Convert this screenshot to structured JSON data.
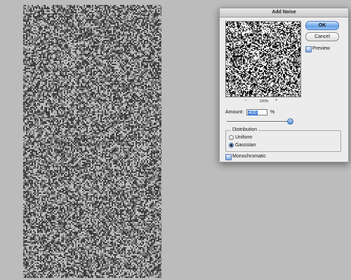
{
  "dialog": {
    "title": "Add Noise",
    "ok_label": "OK",
    "cancel_label": "Cancel",
    "preview_label": "Preview",
    "preview_checked": true,
    "zoom_minus": "−",
    "zoom_percent": "100%",
    "zoom_plus": "+",
    "amount_label": "Amount:",
    "amount_value": "400",
    "amount_unit": "%",
    "amount_slider_level": 1.0,
    "distribution_label": "Distribution",
    "distribution_options": [
      "Uniform",
      "Gaussian"
    ],
    "distribution_selected": "Gaussian",
    "monochromatic_label": "Monochromatic",
    "monochromatic_checked": true
  },
  "colors": {
    "workspace": "#bcbcbc",
    "accent": "#5e95dd"
  }
}
